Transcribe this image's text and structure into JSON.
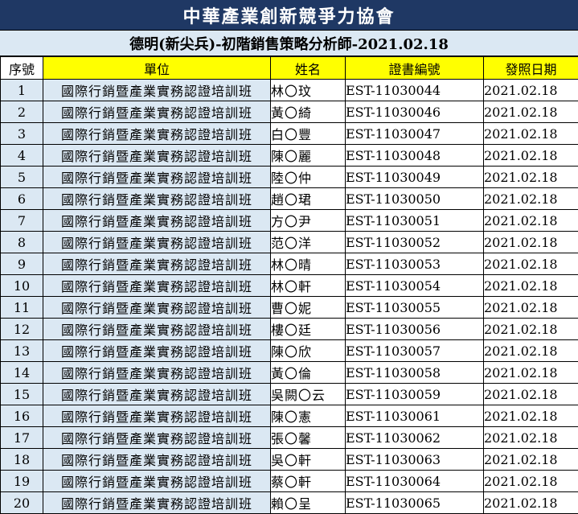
{
  "title": "中華產業創新競爭力協會",
  "subtitle": "德明(新尖兵)-初階銷售策略分析師-2021.02.18",
  "headers": {
    "seq": "序號",
    "unit": "單位",
    "name": "姓名",
    "cert": "證書編號",
    "date": "發照日期"
  },
  "rows": [
    {
      "seq": "1",
      "unit": "國際行銷暨產業實務認證培訓班",
      "name": "林〇玟",
      "cert": "EST-11030044",
      "date": "2021.02.18"
    },
    {
      "seq": "2",
      "unit": "國際行銷暨產業實務認證培訓班",
      "name": "黃〇綺",
      "cert": "EST-11030046",
      "date": "2021.02.18"
    },
    {
      "seq": "3",
      "unit": "國際行銷暨產業實務認證培訓班",
      "name": "白〇豐",
      "cert": "EST-11030047",
      "date": "2021.02.18"
    },
    {
      "seq": "4",
      "unit": "國際行銷暨產業實務認證培訓班",
      "name": "陳〇麗",
      "cert": "EST-11030048",
      "date": "2021.02.18"
    },
    {
      "seq": "5",
      "unit": "國際行銷暨產業實務認證培訓班",
      "name": "陸〇仲",
      "cert": "EST-11030049",
      "date": "2021.02.18"
    },
    {
      "seq": "6",
      "unit": "國際行銷暨產業實務認證培訓班",
      "name": "趙〇珺",
      "cert": "EST-11030050",
      "date": "2021.02.18"
    },
    {
      "seq": "7",
      "unit": "國際行銷暨產業實務認證培訓班",
      "name": "方〇尹",
      "cert": "EST-11030051",
      "date": "2021.02.18"
    },
    {
      "seq": "8",
      "unit": "國際行銷暨產業實務認證培訓班",
      "name": "范〇洋",
      "cert": "EST-11030052",
      "date": "2021.02.18"
    },
    {
      "seq": "9",
      "unit": "國際行銷暨產業實務認證培訓班",
      "name": "林〇晴",
      "cert": "EST-11030053",
      "date": "2021.02.18"
    },
    {
      "seq": "10",
      "unit": "國際行銷暨產業實務認證培訓班",
      "name": "林〇軒",
      "cert": "EST-11030054",
      "date": "2021.02.18"
    },
    {
      "seq": "11",
      "unit": "國際行銷暨產業實務認證培訓班",
      "name": "曹〇妮",
      "cert": "EST-11030055",
      "date": "2021.02.18"
    },
    {
      "seq": "12",
      "unit": "國際行銷暨產業實務認證培訓班",
      "name": "樓〇廷",
      "cert": "EST-11030056",
      "date": "2021.02.18"
    },
    {
      "seq": "13",
      "unit": "國際行銷暨產業實務認證培訓班",
      "name": "陳〇欣",
      "cert": "EST-11030057",
      "date": "2021.02.18"
    },
    {
      "seq": "14",
      "unit": "國際行銷暨產業實務認證培訓班",
      "name": "黃〇倫",
      "cert": "EST-11030058",
      "date": "2021.02.18"
    },
    {
      "seq": "15",
      "unit": "國際行銷暨產業實務認證培訓班",
      "name": "吳闕〇云",
      "cert": "EST-11030059",
      "date": "2021.02.18"
    },
    {
      "seq": "16",
      "unit": "國際行銷暨產業實務認證培訓班",
      "name": "陳〇憲",
      "cert": "EST-11030061",
      "date": "2021.02.18"
    },
    {
      "seq": "17",
      "unit": "國際行銷暨產業實務認證培訓班",
      "name": "張〇馨",
      "cert": "EST-11030062",
      "date": "2021.02.18"
    },
    {
      "seq": "18",
      "unit": "國際行銷暨產業實務認證培訓班",
      "name": "吳〇軒",
      "cert": "EST-11030063",
      "date": "2021.02.18"
    },
    {
      "seq": "19",
      "unit": "國際行銷暨產業實務認證培訓班",
      "name": "蔡〇軒",
      "cert": "EST-11030064",
      "date": "2021.02.18"
    },
    {
      "seq": "20",
      "unit": "國際行銷暨產業實務認證培訓班",
      "name": "賴〇呈",
      "cert": "EST-11030065",
      "date": "2021.02.18"
    }
  ],
  "colors": {
    "banner_bg": "#1f3864",
    "banner_text": "#ffffff",
    "light_blue": "#dbe8f3",
    "header_yellow": "#ffff00"
  }
}
